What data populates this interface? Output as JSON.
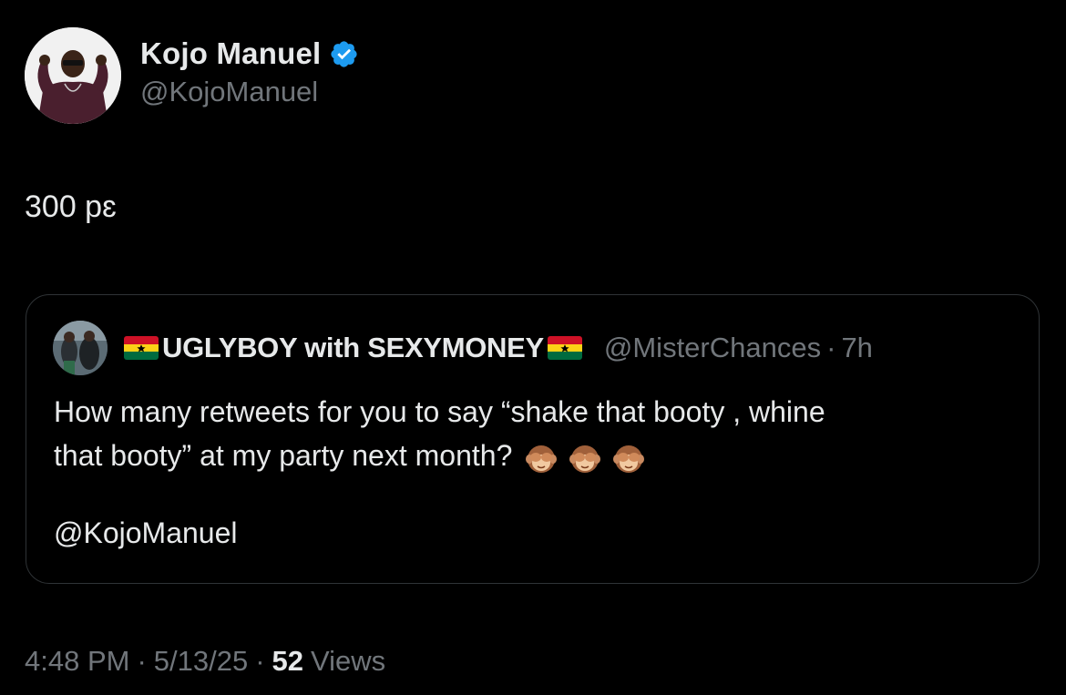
{
  "author": {
    "display_name": "Kojo Manuel",
    "handle": "@KojoManuel",
    "verified": true,
    "avatar_icon": "profile-photo",
    "verified_icon": "verified-badge-icon"
  },
  "tweet": {
    "text": "300 pɛ"
  },
  "quote": {
    "display_name": "UGLYBOY with SEXYMONEY",
    "name_flag_icon": "ghana-flag-icon",
    "handle": "@MisterChances",
    "separator": "·",
    "time": "7h",
    "body_line1": "How many retweets for you to say “shake that booty , whine",
    "body_line2": "that booty” at my party next month?",
    "body_emoji_icon": "see-no-evil-monkey-icon",
    "body_emoji_count": 3,
    "mention": "@KojoManuel"
  },
  "meta": {
    "time": "4:48 PM",
    "separator": "·",
    "date": "5/13/25",
    "views_count": "52",
    "views_label": "Views"
  },
  "colors": {
    "background": "#000000",
    "primary_text": "#e7e9ea",
    "secondary_text": "#71767b",
    "border": "#2f3336",
    "verified_blue": "#1d9bf0"
  }
}
